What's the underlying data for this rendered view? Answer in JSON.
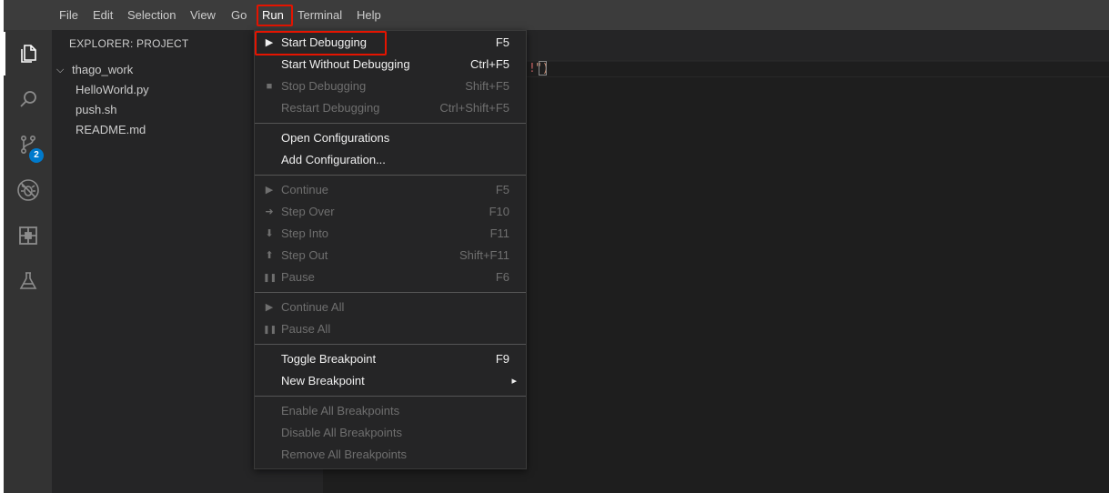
{
  "menubar": {
    "items": [
      "File",
      "Edit",
      "Selection",
      "View",
      "Go",
      "Run",
      "Terminal",
      "Help"
    ]
  },
  "activitybar": {
    "icons": [
      "files-icon",
      "search-icon",
      "source-control-icon",
      "debug-icon",
      "extensions-icon",
      "flask-icon"
    ],
    "source_control_badge": "2"
  },
  "sidebar": {
    "title": "EXPLORER: PROJECT",
    "folder": "thago_work",
    "files": [
      "HelloWorld.py",
      "push.sh",
      "README.md"
    ]
  },
  "editor": {
    "code_fragment_a": "!",
    "code_fragment_b": "\")"
  },
  "run_menu": {
    "groups": [
      [
        {
          "label": "Start Debugging",
          "shortcut": "F5",
          "enabled": true,
          "icon": "play-icon",
          "glyph": "▶"
        },
        {
          "label": "Start Without Debugging",
          "shortcut": "Ctrl+F5",
          "enabled": true
        },
        {
          "label": "Stop Debugging",
          "shortcut": "Shift+F5",
          "enabled": false,
          "icon": "stop-icon",
          "glyph": "■"
        },
        {
          "label": "Restart Debugging",
          "shortcut": "Ctrl+Shift+F5",
          "enabled": false
        }
      ],
      [
        {
          "label": "Open Configurations",
          "shortcut": "",
          "enabled": true
        },
        {
          "label": "Add Configuration...",
          "shortcut": "",
          "enabled": true
        }
      ],
      [
        {
          "label": "Continue",
          "shortcut": "F5",
          "enabled": false,
          "icon": "continue-icon",
          "glyph": "▶"
        },
        {
          "label": "Step Over",
          "shortcut": "F10",
          "enabled": false,
          "icon": "arrow-right-icon",
          "glyph": "➜"
        },
        {
          "label": "Step Into",
          "shortcut": "F11",
          "enabled": false,
          "icon": "arrow-down-icon",
          "glyph": "⬇"
        },
        {
          "label": "Step Out",
          "shortcut": "Shift+F11",
          "enabled": false,
          "icon": "arrow-up-icon",
          "glyph": "⬆"
        },
        {
          "label": "Pause",
          "shortcut": "F6",
          "enabled": false,
          "icon": "pause-icon",
          "glyph": "❚❚"
        }
      ],
      [
        {
          "label": "Continue All",
          "shortcut": "",
          "enabled": false,
          "icon": "continue-icon",
          "glyph": "▶"
        },
        {
          "label": "Pause All",
          "shortcut": "",
          "enabled": false,
          "icon": "pause-icon",
          "glyph": "❚❚"
        }
      ],
      [
        {
          "label": "Toggle Breakpoint",
          "shortcut": "F9",
          "enabled": true
        },
        {
          "label": "New Breakpoint",
          "shortcut": "▸",
          "enabled": true
        }
      ],
      [
        {
          "label": "Enable All Breakpoints",
          "shortcut": "",
          "enabled": false
        },
        {
          "label": "Disable All Breakpoints",
          "shortcut": "",
          "enabled": false
        },
        {
          "label": "Remove All Breakpoints",
          "shortcut": "",
          "enabled": false
        }
      ]
    ]
  },
  "colors": {
    "highlight": "#e51400",
    "badge": "#007acc"
  }
}
